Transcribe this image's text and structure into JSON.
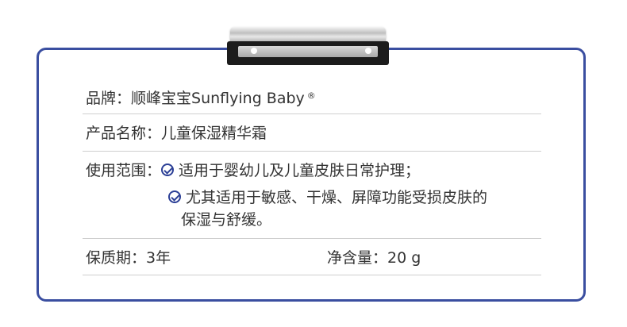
{
  "brand": {
    "label": "品牌：",
    "value": "顺峰宝宝Sunflying Baby",
    "reg": "®"
  },
  "product": {
    "label": "产品名称：",
    "value": "儿童保湿精华霜"
  },
  "usage": {
    "label": "使用范围：",
    "items": [
      {
        "icon": "check-circle-icon",
        "line1": "适用于婴幼儿及儿童皮肤日常护理；"
      },
      {
        "icon": "check-circle-icon",
        "line1": "尤其适用于敏感、干燥、屏障功能受损皮肤的",
        "line2": "保湿与舒缓。"
      }
    ]
  },
  "shelf_life": {
    "label": "保质期：",
    "value": "3年"
  },
  "net_content": {
    "label": "净含量：",
    "value": "20 g"
  },
  "colors": {
    "border": "#3a4ea0",
    "icon": "#2b3f96",
    "text": "#333333",
    "divider": "#cfcfcf"
  }
}
